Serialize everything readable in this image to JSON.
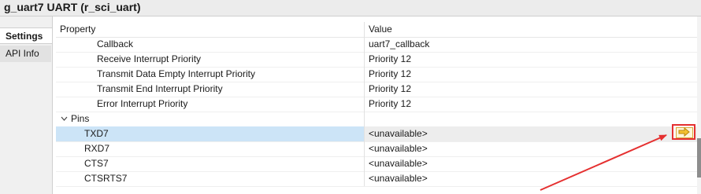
{
  "header": {
    "title": "g_uart7 UART (r_sci_uart)"
  },
  "tabs": [
    {
      "label": "Settings",
      "active": true
    },
    {
      "label": "API Info",
      "active": false
    }
  ],
  "table": {
    "columns": [
      "Property",
      "Value"
    ],
    "rows": [
      {
        "property": "Callback",
        "value": "uart7_callback"
      },
      {
        "property": "Receive Interrupt Priority",
        "value": "Priority 12"
      },
      {
        "property": "Transmit Data Empty Interrupt Priority",
        "value": "Priority 12"
      },
      {
        "property": "Transmit End Interrupt Priority",
        "value": "Priority 12"
      },
      {
        "property": "Error Interrupt Priority",
        "value": "Priority 12"
      },
      {
        "property": "Pins",
        "value": ""
      },
      {
        "property": "TXD7",
        "value": "<unavailable>"
      },
      {
        "property": "RXD7",
        "value": "<unavailable>"
      },
      {
        "property": "CTS7",
        "value": "<unavailable>"
      },
      {
        "property": "CTSRTS7",
        "value": "<unavailable>"
      }
    ]
  },
  "icons": {
    "pins_toggle": "chevron-down-icon",
    "navigate": "arrow-right-icon"
  },
  "colors": {
    "selected_row": "#cce4f7",
    "annotation": "#e53030",
    "nav_button_fill": "#fff6d9",
    "nav_button_border": "#d7a93a"
  }
}
